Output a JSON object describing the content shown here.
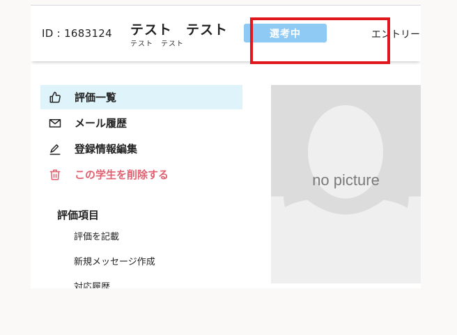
{
  "header": {
    "student_id": "ID : 1683124",
    "name": "テスト　テスト",
    "name_kana": "テスト　テスト",
    "status_label": "選考中",
    "entry_label": "エントリー"
  },
  "menu": {
    "items": [
      {
        "label": "評価一覧",
        "icon": "thumbs-up-icon"
      },
      {
        "label": "メール履歴",
        "icon": "mail-icon"
      },
      {
        "label": "登録情報編集",
        "icon": "pencil-icon"
      },
      {
        "label": "この学生を削除する",
        "icon": "trash-icon"
      }
    ]
  },
  "evaluation": {
    "title": "評価項目",
    "links": [
      "評価を記載",
      "新規メッセージ作成",
      "対応履歴"
    ]
  },
  "profile": {
    "no_picture": "no picture"
  },
  "colors": {
    "accent": "#8fcaf4",
    "active_bg": "#dff3fb",
    "danger": "#e06070",
    "highlight": "#e0171c"
  }
}
